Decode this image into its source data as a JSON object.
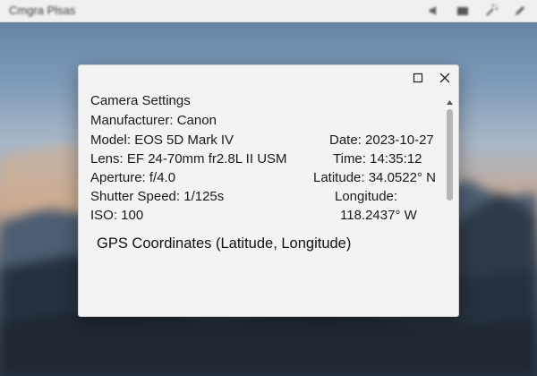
{
  "app": {
    "title": "Cmgra Plsas"
  },
  "topbar": {
    "icons": [
      "speaker-icon",
      "folder-icon",
      "wrench-icon",
      "edit-icon"
    ]
  },
  "dialog": {
    "controls": {
      "maximize_icon": "maximize-icon",
      "close_icon": "close-icon"
    },
    "section_title": "Camera Settings",
    "left_rows": [
      "Manufacturer: Canon",
      "Model: EOS 5D Mark IV",
      "Lens: EF 24-70mm fr2.8L II USM",
      "Aperture: f/4.0",
      "Shutter Speed: 1/125s",
      "ISO: 100"
    ],
    "right_rows": [
      "Date: 2023-10-27",
      "Time: 14:35:12",
      "Latitude: 34.0522° N",
      "Longitude:",
      "118.2437° W"
    ],
    "gps_heading": "GPS Coordinates (Latitude, Longitude)"
  },
  "colors": {
    "dialog_bg": "#f3f3f3",
    "text": "#1a1a1a",
    "scroll_thumb": "#b5b5b5"
  }
}
